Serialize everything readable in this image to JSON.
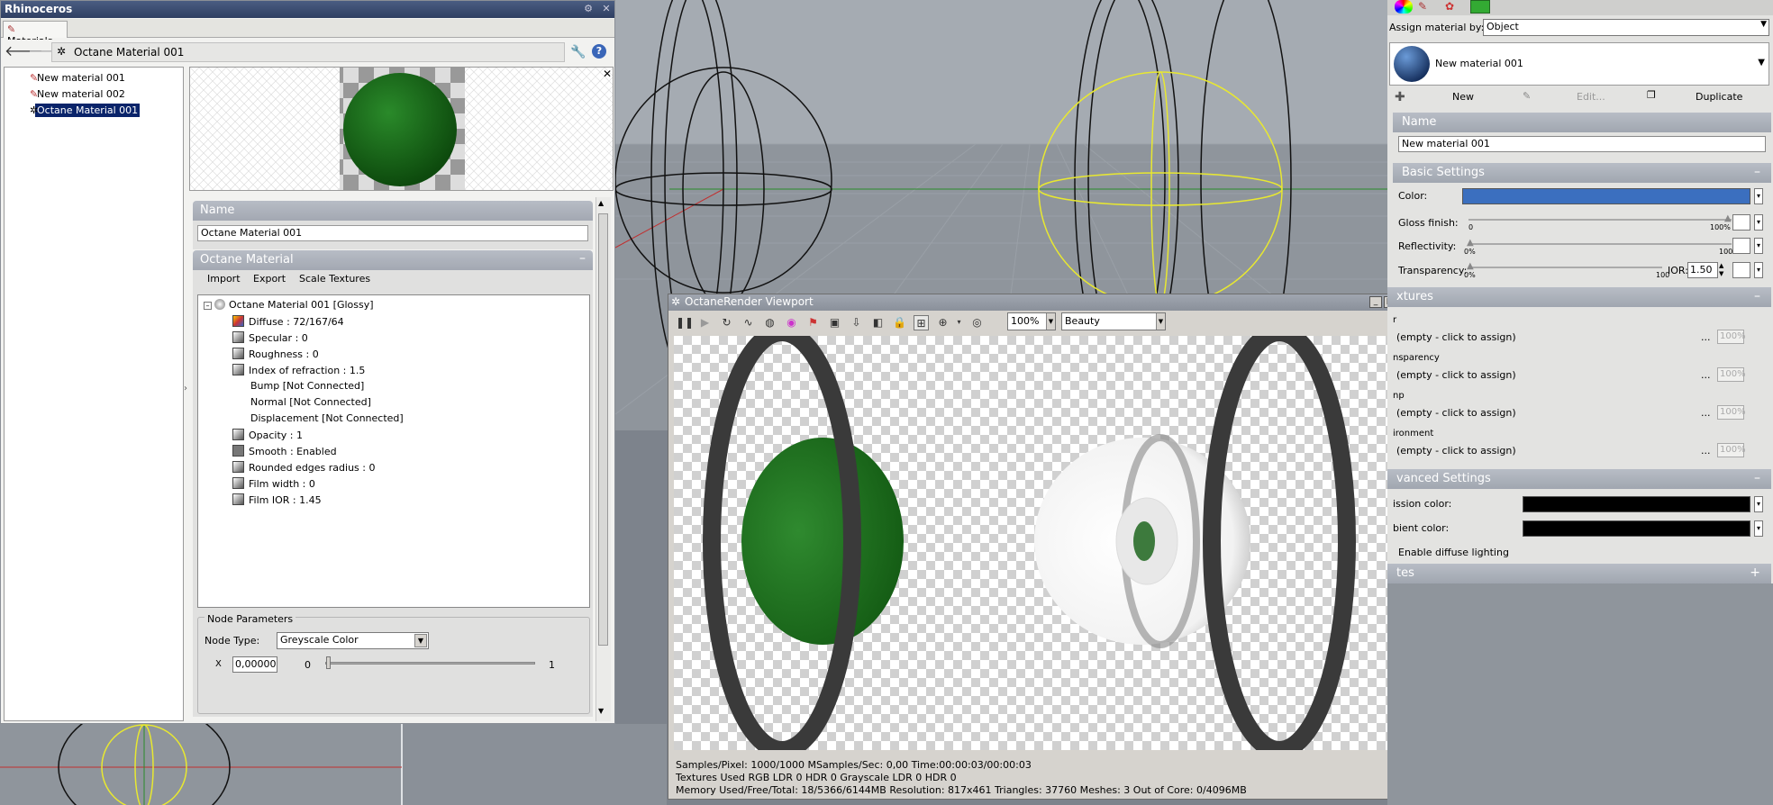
{
  "rhino_dialog": {
    "title": "Rhinoceros",
    "tab": "Materials",
    "current_path": "Octane Material 001",
    "materials": [
      "New material 001",
      "New material 002",
      "Octane Material 001"
    ],
    "selected_material": "Octane Material 001",
    "name_section": "Name",
    "name_value": "Octane Material 001",
    "octane_section": "Octane Material",
    "buttons": {
      "import": "Import",
      "export": "Export",
      "scale": "Scale Textures"
    },
    "tree": {
      "root": "Octane Material 001  [Glossy]",
      "items": [
        "Diffuse : 72/167/64",
        "Specular : 0",
        "Roughness : 0",
        "Index of refraction : 1.5",
        "Bump  [Not Connected]",
        "Normal  [Not Connected]",
        "Displacement  [Not Connected]",
        "Opacity : 1",
        "Smooth : Enabled",
        "Rounded edges radius : 0",
        "Film width : 0",
        "Film IOR : 1.45"
      ]
    },
    "node_params": {
      "legend": "Node Parameters",
      "node_type_label": "Node Type:",
      "node_type_value": "Greyscale Color",
      "x_label": "X",
      "x_value": "0,00000",
      "min": "0",
      "max": "1"
    }
  },
  "octane": {
    "title": "OctaneRender Viewport",
    "zoom": "100%",
    "mode": "Beauty",
    "status1": "Samples/Pixel: 1000/1000  MSamples/Sec: 0,00  Time:00:00:03/00:00:03",
    "status2": "Textures Used RGB LDR 0  HDR 0  Grayscale LDR 0  HDR 0",
    "status3": "Memory Used/Free/Total: 18/5366/6144MB  Resolution: 817x461  Triangles: 37760  Meshes: 3 Out of Core: 0/4096MB"
  },
  "right_panel": {
    "assign_label": "Assign material by:",
    "assign_value": "Object",
    "material_name": "New material 001",
    "buttons": {
      "new": "New",
      "edit": "Edit...",
      "duplicate": "Duplicate"
    },
    "name_section": "Name",
    "name_value": "New material 001",
    "basic_section": "Basic Settings",
    "color_label": "Color:",
    "color_hex": "#3b6fbf",
    "gloss_label": "Gloss finish:",
    "gloss_min": "0",
    "gloss_max": "100%",
    "reflect_label": "Reflectivity:",
    "reflect_min": "0%",
    "reflect_max": "100",
    "transp_label": "Transparency:",
    "transp_min": "0%",
    "transp_max": "100",
    "ior_label": "IOR:",
    "ior_value": "1.50",
    "textures_section": "xtures",
    "textures": [
      {
        "label": "r",
        "value": "(empty - click to assign)",
        "pct": "100%"
      },
      {
        "label": "nsparency",
        "value": "(empty - click to assign)",
        "pct": "100%"
      },
      {
        "label": "np",
        "value": "(empty - click to assign)",
        "pct": "100%"
      },
      {
        "label": "ironment",
        "value": "(empty - click to assign)",
        "pct": "100%"
      }
    ],
    "dots": "...",
    "advanced_section": "vanced Settings",
    "emission_label": "ission color:",
    "ambient_label": "bient color:",
    "diffuse_lighting": "Enable diffuse lighting",
    "notes_section": "tes"
  }
}
